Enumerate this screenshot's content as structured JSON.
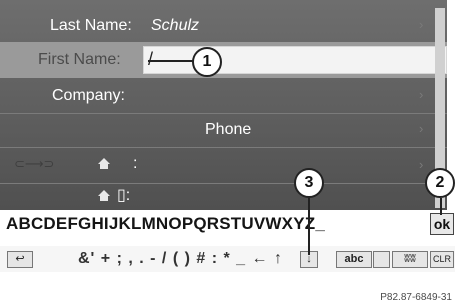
{
  "form": {
    "last_name_label": "Last Name:",
    "last_name_value": "Schulz",
    "first_name_label": "First Name:",
    "first_name_value": "/",
    "company_label": "Company:",
    "phone_label": "Phone",
    "address_1_value": ":",
    "address_2_value": "▯:"
  },
  "keyboard": {
    "letters": "ABCDEFGHIJKLMNOPQRSTUVWXYZ_",
    "ok_label": "ok",
    "symbols": "&' + ; , . - / ( ) # : * _ ← ↑",
    "down_arrow": "↓",
    "abc_label": "abc",
    "clr_label": "CLR",
    "back_label": "↩"
  },
  "callouts": {
    "one": "1",
    "two": "2",
    "three": "3"
  },
  "figure_code": "P82.87-6849-31",
  "icons": [
    "home-icon",
    "back-icon",
    "space-icon",
    "clr-icon"
  ],
  "colors": {
    "screen_bg": "#5e5e5e",
    "highlight_row": "#9a9a9a",
    "field_bg": "#f3f3f3"
  }
}
